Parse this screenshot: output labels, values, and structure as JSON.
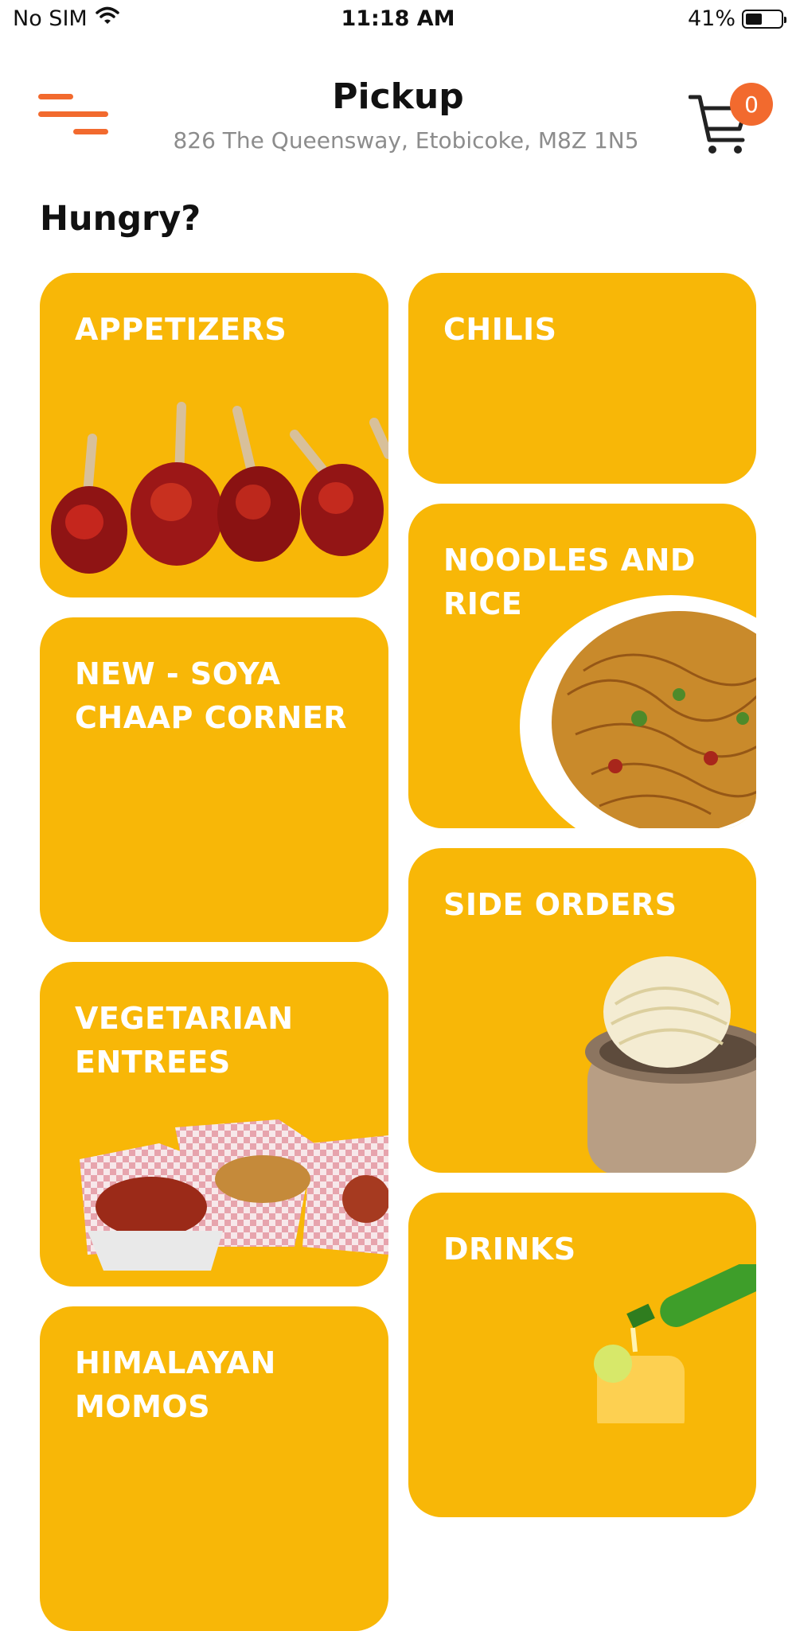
{
  "status_bar": {
    "carrier": "No SIM",
    "time": "11:18 AM",
    "battery": "41%",
    "battery_level": 0.41
  },
  "header": {
    "title": "Pickup",
    "address": "826 The Queensway, Etobicoke, M8Z 1N5",
    "cart_count": "0",
    "menu_icon": "hamburger-menu-icon",
    "cart_icon": "shopping-cart-icon",
    "accent_color": "#f26a2e"
  },
  "section_title": "Hungry?",
  "card_color": "#f8b707",
  "categories": [
    {
      "label": "APPETIZERS",
      "image": "chicken-lollipop"
    },
    {
      "label": "CHILIS",
      "image": ""
    },
    {
      "label": "NOODLES AND RICE",
      "image": "noodles-plate"
    },
    {
      "label": "NEW - SOYA CHAAP CORNER",
      "image": ""
    },
    {
      "label": "SIDE ORDERS",
      "image": "steamed-bun"
    },
    {
      "label": "VEGETARIAN ENTREES",
      "image": "takeout-boxes"
    },
    {
      "label": "DRINKS",
      "image": "lemonade-bottle"
    },
    {
      "label": "HIMALAYAN MOMOS",
      "image": ""
    }
  ]
}
